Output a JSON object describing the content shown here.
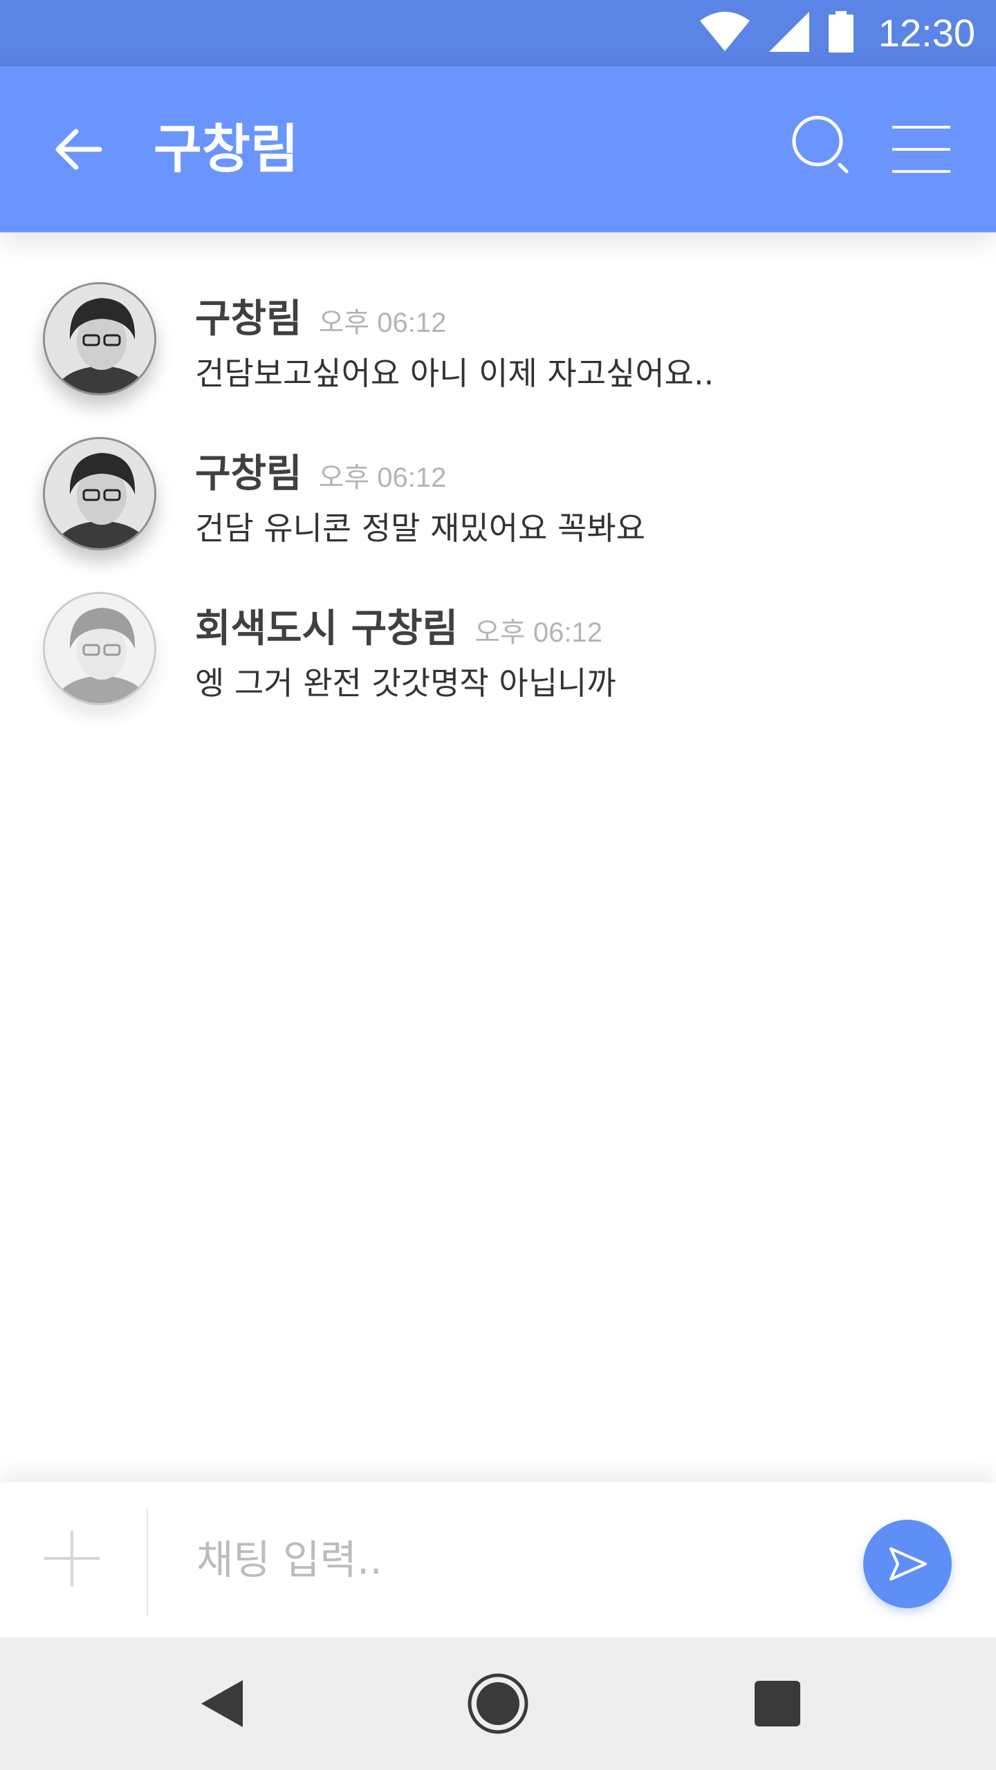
{
  "status_bar": {
    "time": "12:30",
    "icons": [
      "wifi-icon",
      "cell-signal-icon",
      "battery-icon"
    ]
  },
  "app_bar": {
    "title": "구창림",
    "back_icon": "arrow-back-icon",
    "search_icon": "search-icon",
    "menu_icon": "menu-icon",
    "background": "#6a95fe"
  },
  "messages": [
    {
      "sender": "구창림",
      "time": "오후 06:12",
      "text": "건담보고싶어요 아니 이제 자고싶어요..",
      "avatar_style": "normal"
    },
    {
      "sender": "구창림",
      "time": "오후 06:12",
      "text": "건담 유니콘 정말 재밌어요 꼭봐요",
      "avatar_style": "normal"
    },
    {
      "sender": "회색도시 구창림",
      "time": "오후 06:12",
      "text": "엥 그거 완전 갓갓명작 아닙니까",
      "avatar_style": "faded"
    }
  ],
  "input_bar": {
    "placeholder": "채팅 입력..",
    "value": "",
    "add_icon": "plus-icon",
    "send_icon": "send-icon",
    "accent": "#5e8ff7"
  },
  "nav_bar": {
    "icons": [
      "back-triangle-icon",
      "home-circle-icon",
      "recents-square-icon"
    ]
  }
}
